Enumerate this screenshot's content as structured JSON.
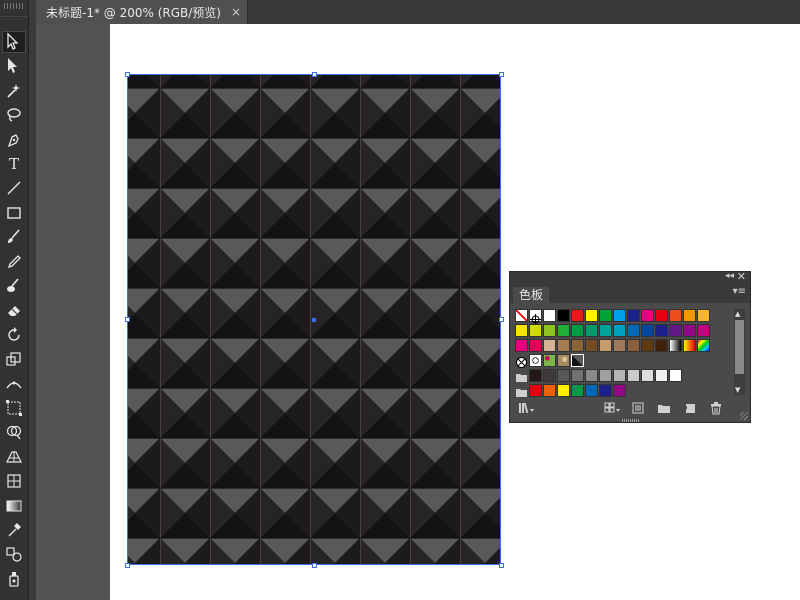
{
  "document_tab": {
    "title": "未标题-1* @ 200% (RGB/预览)",
    "close_glyph": "×"
  },
  "tools": [
    {
      "name": "selection-tool-icon",
      "active": true
    },
    {
      "name": "direct-selection-tool-icon"
    },
    {
      "name": "magic-wand-tool-icon"
    },
    {
      "name": "lasso-tool-icon"
    },
    {
      "name": "pen-tool-icon"
    },
    {
      "name": "type-tool-icon",
      "glyph": "T"
    },
    {
      "name": "line-segment-tool-icon"
    },
    {
      "name": "rectangle-tool-icon"
    },
    {
      "name": "paintbrush-tool-icon"
    },
    {
      "name": "pencil-tool-icon"
    },
    {
      "name": "blob-brush-tool-icon"
    },
    {
      "name": "eraser-tool-icon"
    },
    {
      "name": "rotate-tool-icon"
    },
    {
      "name": "scale-tool-icon"
    },
    {
      "name": "width-tool-icon"
    },
    {
      "name": "free-transform-tool-icon"
    },
    {
      "name": "shape-builder-tool-icon"
    },
    {
      "name": "perspective-grid-tool-icon"
    },
    {
      "name": "mesh-tool-icon"
    },
    {
      "name": "gradient-tool-icon"
    },
    {
      "name": "eyedropper-tool-icon"
    },
    {
      "name": "blend-tool-icon"
    },
    {
      "name": "symbol-sprayer-tool-icon"
    }
  ],
  "swatches_panel": {
    "tab_label": "色板",
    "collapse_glyph": "◂◂",
    "close_glyph": "✕",
    "menu_glyph": "▾≡",
    "scroll_position": 0.1,
    "rows": [
      {
        "kind": "colors",
        "colors": [
          "none",
          "registration",
          "#ffffff",
          "#000000",
          "#e6191b",
          "#fff100",
          "#00a23c",
          "#00a0e9",
          "#1d2088",
          "#e4007f",
          "#e60012",
          "#e94e1b",
          "#f39800",
          "#f8b62d"
        ]
      },
      {
        "kind": "colors",
        "colors": [
          "#f2e600",
          "#cfdb00",
          "#8fc31f",
          "#22ac38",
          "#009944",
          "#009b6b",
          "#00a29a",
          "#00a0c1",
          "#0068b7",
          "#00479d",
          "#1d2088",
          "#601986",
          "#920783",
          "#be0081"
        ]
      },
      {
        "kind": "colors",
        "colors": [
          "#e4007f",
          "#e5005a",
          "#d3b393",
          "#a67c52",
          "#8c6239",
          "#754c24",
          "#c69c6d",
          "#a0785a",
          "#8b5e3c",
          "#603913",
          "#42210b",
          "gradient-bw",
          "gradient-orange",
          "gradient-rainbow"
        ]
      },
      {
        "kind": "patterns",
        "colors": [
          "pattern-circles",
          "pattern-leaves",
          "pattern-texture",
          "pattern-pyramid"
        ]
      },
      {
        "kind": "group",
        "colors": [
          "#231815",
          "#3e3a39",
          "#595757",
          "#727171",
          "#898989",
          "#9fa0a0",
          "#b5b5b6",
          "#c9caca",
          "#dcdddd",
          "#efefef",
          "#ffffff"
        ]
      },
      {
        "kind": "group",
        "colors": [
          "#e60012",
          "#eb6100",
          "#fff100",
          "#009944",
          "#0068b7",
          "#1d2088",
          "#920783"
        ]
      }
    ]
  },
  "colors": {
    "selection": "#3c6fe0",
    "pattern_dark": "#141214",
    "pattern_light": "#5a585a",
    "pattern_mid": "#2e2c2e",
    "pattern_gridline": "#6a5e4c"
  }
}
